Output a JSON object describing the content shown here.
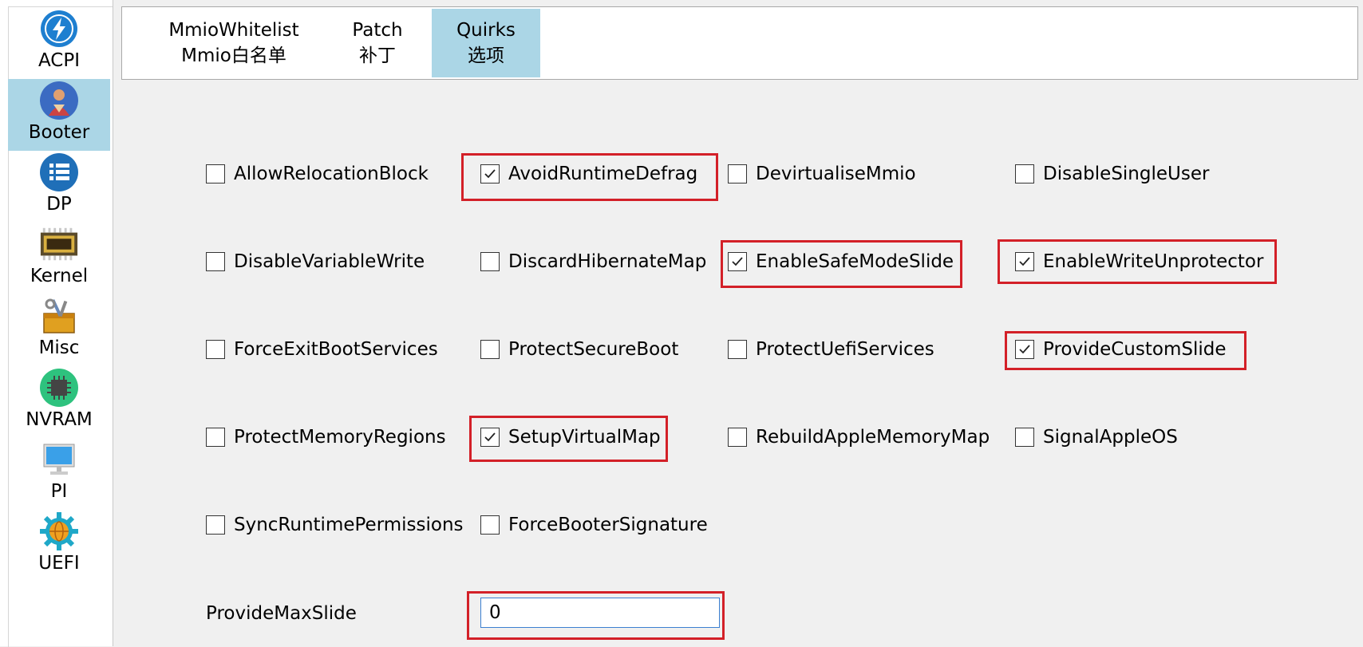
{
  "sidebar": {
    "items": [
      {
        "label": "ACPI",
        "icon": "lightning-icon",
        "active": false
      },
      {
        "label": "Booter",
        "icon": "avatar-icon",
        "active": true
      },
      {
        "label": "DP",
        "icon": "list-icon",
        "active": false
      },
      {
        "label": "Kernel",
        "icon": "chip-icon",
        "active": false
      },
      {
        "label": "Misc",
        "icon": "toolbox-icon",
        "active": false
      },
      {
        "label": "NVRAM",
        "icon": "cpu-icon",
        "active": false
      },
      {
        "label": "PI",
        "icon": "monitor-icon",
        "active": false
      },
      {
        "label": "UEFI",
        "icon": "globe-gear-icon",
        "active": false
      }
    ]
  },
  "tabs": [
    {
      "line1": "MmioWhitelist",
      "line2": "Mmio白名单",
      "active": false
    },
    {
      "line1": "Patch",
      "line2": "补丁",
      "active": false
    },
    {
      "line1": "Quirks",
      "line2": "选项",
      "active": true
    }
  ],
  "quirks": [
    {
      "label": "AllowRelocationBlock",
      "checked": false
    },
    {
      "label": "AvoidRuntimeDefrag",
      "checked": true
    },
    {
      "label": "DevirtualiseMmio",
      "checked": false
    },
    {
      "label": "DisableSingleUser",
      "checked": false
    },
    {
      "label": "DisableVariableWrite",
      "checked": false
    },
    {
      "label": "DiscardHibernateMap",
      "checked": false
    },
    {
      "label": "EnableSafeModeSlide",
      "checked": true
    },
    {
      "label": "EnableWriteUnprotector",
      "checked": true
    },
    {
      "label": "ForceExitBootServices",
      "checked": false
    },
    {
      "label": "ProtectSecureBoot",
      "checked": false
    },
    {
      "label": "ProtectUefiServices",
      "checked": false
    },
    {
      "label": "ProvideCustomSlide",
      "checked": true
    },
    {
      "label": "ProtectMemoryRegions",
      "checked": false
    },
    {
      "label": "SetupVirtualMap",
      "checked": true
    },
    {
      "label": "RebuildAppleMemoryMap",
      "checked": false
    },
    {
      "label": "SignalAppleOS",
      "checked": false
    },
    {
      "label": "SyncRuntimePermissions",
      "checked": false
    },
    {
      "label": "ForceBooterSignature",
      "checked": false
    }
  ],
  "provide_max_slide": {
    "label": "ProvideMaxSlide",
    "value": "0"
  },
  "colors": {
    "highlight": "#d32028",
    "active_bg": "#abd6e6"
  }
}
